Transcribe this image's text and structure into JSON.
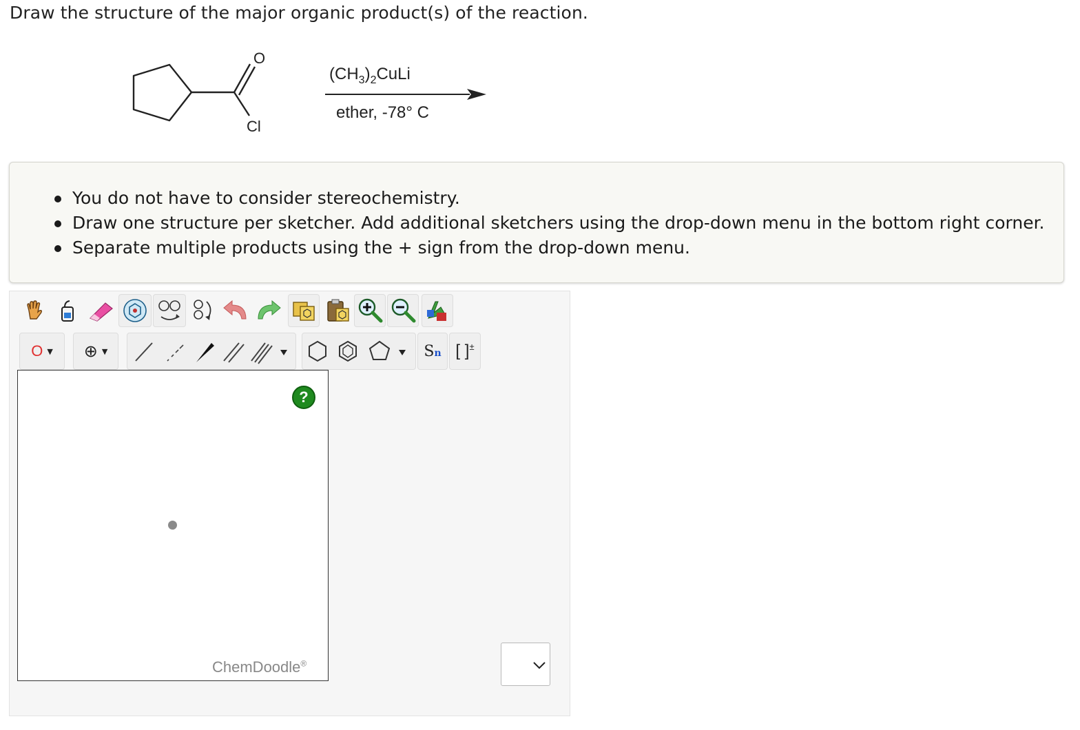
{
  "question": "Draw the structure of the major organic product(s) of the reaction.",
  "reaction": {
    "reactant_atoms": {
      "oxygen": "O",
      "chlorine": "Cl"
    },
    "reagent_main": "(CH",
    "reagent_sub1": "3",
    "reagent_mid": ")",
    "reagent_sub2": "2",
    "reagent_end": "CuLi",
    "conditions": "ether, -78° C"
  },
  "notes": [
    "You do not have to consider stereochemistry.",
    "Draw one structure per sketcher. Add additional sketchers using the drop-down menu in the bottom right corner.",
    "Separate multiple products using the + sign from the drop-down menu."
  ],
  "toolbar": {
    "row1": [
      "hand-icon",
      "lasso-icon",
      "eraser-icon",
      "clean-icon",
      "flip-icon",
      "rotate-icon",
      "undo-icon",
      "redo-icon",
      "copy-icon",
      "paste-icon",
      "zoom-in-icon",
      "zoom-out-icon",
      "atom-colors-icon"
    ],
    "atom_label": "O",
    "charge_label": "⊕",
    "sn_label": "S",
    "sn_sub": "n",
    "bracket_label": "[ ]",
    "bracket_sup": "±"
  },
  "canvas": {
    "help_label": "?",
    "brand": "ChemDoodle",
    "brand_mark": "®"
  },
  "colors": {
    "oxygen": "#e03030",
    "help_green": "#1f8a1f",
    "notes_bg": "#f8f8f4"
  }
}
